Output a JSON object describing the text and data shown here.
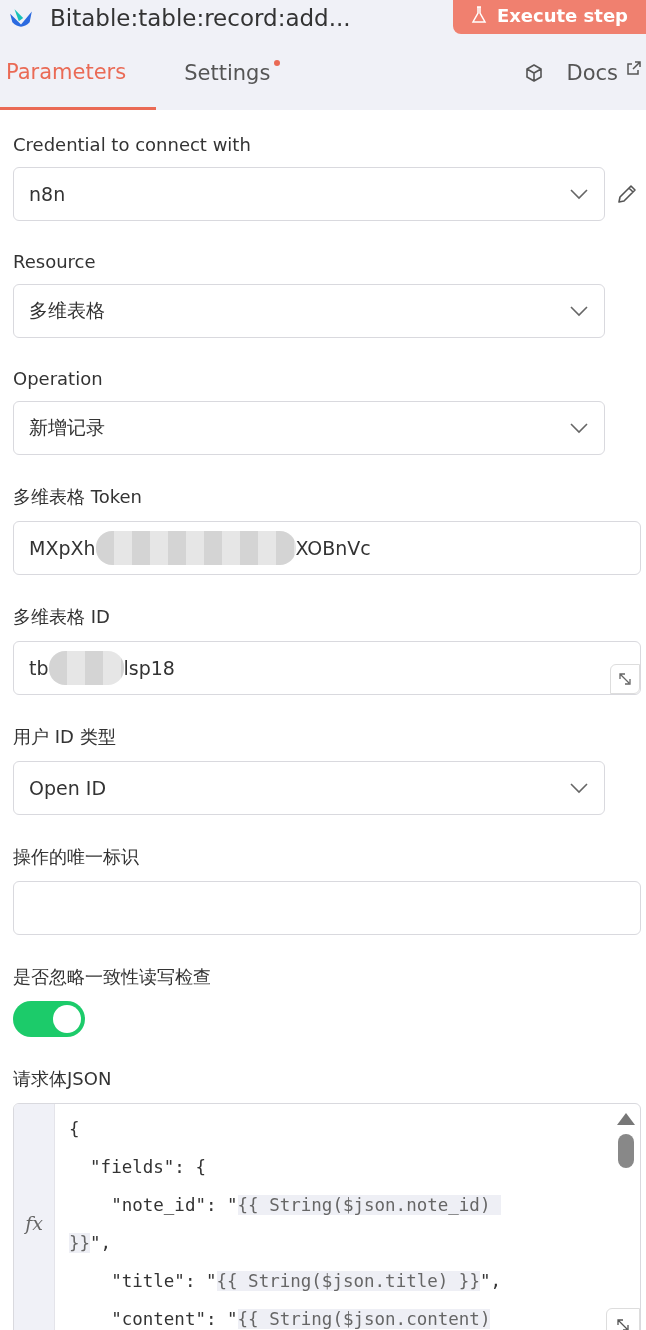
{
  "header": {
    "title": "Bitable:table:record:add...",
    "execute_button": {
      "label": "Execute step",
      "disabled": true
    }
  },
  "tabs": [
    {
      "label": "Parameters",
      "selected": true,
      "dot": false
    },
    {
      "label": "Settings",
      "selected": false,
      "dot": true
    }
  ],
  "docs_link": "Docs",
  "fields": [
    {
      "kind": "select",
      "label": "Credential to connect with",
      "value": "n8n",
      "editable": true
    },
    {
      "kind": "select",
      "label": "Resource",
      "value": "多维表格"
    },
    {
      "kind": "select",
      "label": "Operation",
      "value": "新增记录"
    },
    {
      "kind": "redacted",
      "label": "多维表格 Token",
      "prefix": "MXpXh",
      "suffix": "XOBnVc"
    },
    {
      "kind": "redacted",
      "label": "多维表格 ID",
      "prefix": "tb",
      "suffix": "lsp18",
      "expandable": true
    },
    {
      "kind": "select",
      "label": "用户 ID 类型",
      "value": "Open ID"
    },
    {
      "kind": "text",
      "label": "操作的唯一标识"
    },
    {
      "kind": "toggle",
      "label": "是否忽略一致性读写检查",
      "on": true
    },
    {
      "kind": "code",
      "label": "请求体JSON",
      "gutter": "fx",
      "lines": [
        [
          {
            "t": "{"
          }
        ],
        [
          {
            "t": "  \"fields\": {"
          }
        ],
        [
          {
            "t": "    \"note_id\": \""
          },
          {
            "t": "{{ String($json.note_id) ",
            "expr": true
          }
        ],
        [
          {
            "t": "}}",
            "expr": true
          },
          {
            "t": "\","
          }
        ],
        [
          {
            "t": "    \"title\": \""
          },
          {
            "t": "{{ String($json.title) }}",
            "expr": true
          },
          {
            "t": "\","
          }
        ],
        [
          {
            "t": "    \"content\": \""
          },
          {
            "t": "{{ String($json.content)",
            "expr": true
          }
        ]
      ]
    }
  ]
}
